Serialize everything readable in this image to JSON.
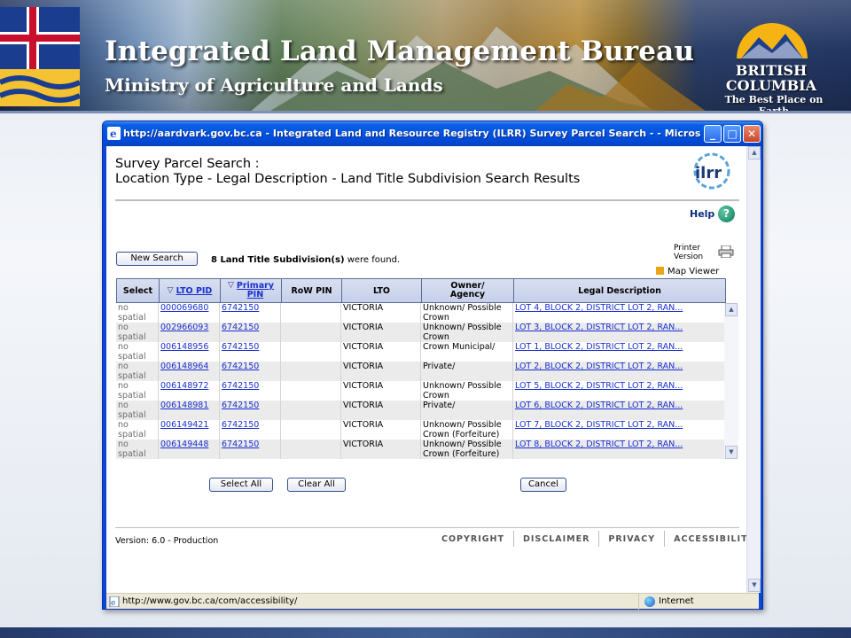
{
  "banner": {
    "title": "Integrated Land Management Bureau",
    "subtitle": "Ministry of Agriculture and Lands",
    "logo_line1": "BRITISH",
    "logo_line2": "COLUMBIA",
    "logo_tagline": "The Best Place on Earth"
  },
  "window": {
    "title": "http://aardvark.gov.bc.ca - Integrated Land and Resource Registry (ILRR) Survey Parcel Search - - Microsoft Int...",
    "minimize": "_",
    "maximize": "□",
    "close": "✕",
    "status_url": "http://www.gov.bc.ca/com/accessibility/",
    "status_zone": "Internet"
  },
  "page": {
    "title_line1": "Survey Parcel Search :",
    "title_line2": "Location Type - Legal Description - Land Title Subdivision Search Results",
    "help": "Help",
    "printer_line1": "Printer",
    "printer_line2": "Version",
    "new_search": "New Search",
    "found_count": "8 Land Title Subdivision(s)",
    "found_suffix": " were found.",
    "map_viewer": "Map Viewer",
    "select_all": "Select All",
    "clear_all": "Clear All",
    "cancel": "Cancel",
    "version": "Version: 6.0 - Production",
    "footer": [
      "COPYRIGHT",
      "DISCLAIMER",
      "PRIVACY",
      "ACCESSIBILITY"
    ]
  },
  "table": {
    "headers": {
      "select": "Select",
      "lto_pid": "LTO PID",
      "primary_pin_1": "Primary",
      "primary_pin_2": "PIN",
      "row_pin": "RoW PIN",
      "lto": "LTO",
      "owner_1": "Owner/",
      "owner_2": "Agency",
      "legal": "Legal Description"
    },
    "rows": [
      {
        "select1": "no",
        "select2": "spatial",
        "lto_pid": "000069680",
        "pin": "6742150",
        "row_pin": "",
        "lto": "VICTORIA",
        "owner1": "Unknown/ Possible",
        "owner2": "Crown",
        "legal": "LOT 4, BLOCK 2, DISTRICT LOT 2, RAN..."
      },
      {
        "select1": "no",
        "select2": "spatial",
        "lto_pid": "002966093",
        "pin": "6742150",
        "row_pin": "",
        "lto": "VICTORIA",
        "owner1": "Unknown/ Possible",
        "owner2": "Crown",
        "legal": "LOT 3, BLOCK 2, DISTRICT LOT 2, RAN..."
      },
      {
        "select1": "no",
        "select2": "spatial",
        "lto_pid": "006148956",
        "pin": "6742150",
        "row_pin": "",
        "lto": "VICTORIA",
        "owner1": "Crown Municipal/",
        "owner2": "",
        "legal": "LOT 1, BLOCK 2, DISTRICT LOT 2, RAN..."
      },
      {
        "select1": "no",
        "select2": "spatial",
        "lto_pid": "006148964",
        "pin": "6742150",
        "row_pin": "",
        "lto": "VICTORIA",
        "owner1": "Private/",
        "owner2": "",
        "legal": "LOT 2, BLOCK 2, DISTRICT LOT 2, RAN..."
      },
      {
        "select1": "no",
        "select2": "spatial",
        "lto_pid": "006148972",
        "pin": "6742150",
        "row_pin": "",
        "lto": "VICTORIA",
        "owner1": "Unknown/ Possible",
        "owner2": "Crown",
        "legal": "LOT 5, BLOCK 2, DISTRICT LOT 2, RAN..."
      },
      {
        "select1": "no",
        "select2": "spatial",
        "lto_pid": "006148981",
        "pin": "6742150",
        "row_pin": "",
        "lto": "VICTORIA",
        "owner1": "Private/",
        "owner2": "",
        "legal": "LOT 6, BLOCK 2, DISTRICT LOT 2, RAN..."
      },
      {
        "select1": "no",
        "select2": "spatial",
        "lto_pid": "006149421",
        "pin": "6742150",
        "row_pin": "",
        "lto": "VICTORIA",
        "owner1": "Unknown/ Possible",
        "owner2": "Crown (Forfeiture)",
        "legal": "LOT 7, BLOCK 2, DISTRICT LOT 2, RAN..."
      },
      {
        "select1": "no",
        "select2": "spatial",
        "lto_pid": "006149448",
        "pin": "6742150",
        "row_pin": "",
        "lto": "VICTORIA",
        "owner1": "Unknown/ Possible",
        "owner2": "Crown (Forfeiture)",
        "legal": "LOT 8, BLOCK 2, DISTRICT LOT 2, RAN..."
      }
    ]
  },
  "icons": [
    "flag-icon",
    "ie-icon",
    "ilrr-logo-icon",
    "help-icon",
    "printer-icon",
    "map-viewer-icon",
    "sort-triangle-icon",
    "globe-icon"
  ],
  "colors": {
    "titlebar": "#0053e0",
    "link": "#1a2fd0",
    "header_bg": "#c6d0ea",
    "row_alt": "#ebebeb"
  }
}
